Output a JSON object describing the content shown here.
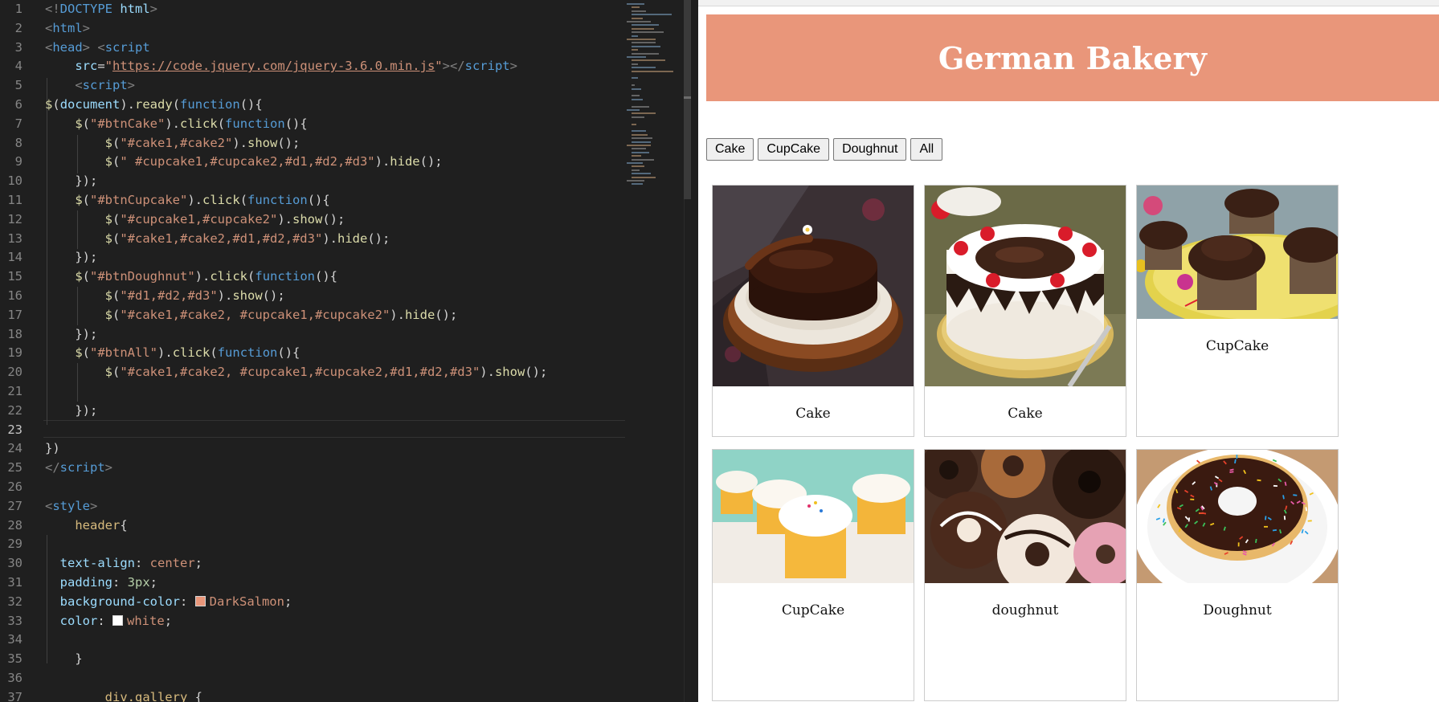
{
  "editor": {
    "lines": [
      {
        "n": "1"
      },
      {
        "n": "2"
      },
      {
        "n": "3"
      },
      {
        "n": "4"
      },
      {
        "n": "5"
      },
      {
        "n": "6"
      },
      {
        "n": "7"
      },
      {
        "n": "8"
      },
      {
        "n": "9"
      },
      {
        "n": "10"
      },
      {
        "n": "11"
      },
      {
        "n": "12"
      },
      {
        "n": "13"
      },
      {
        "n": "14"
      },
      {
        "n": "15"
      },
      {
        "n": "16"
      },
      {
        "n": "17"
      },
      {
        "n": "18"
      },
      {
        "n": "19"
      },
      {
        "n": "20"
      },
      {
        "n": "21"
      },
      {
        "n": "22"
      },
      {
        "n": "23"
      },
      {
        "n": "24"
      },
      {
        "n": "25"
      },
      {
        "n": "26"
      },
      {
        "n": "27"
      },
      {
        "n": "28"
      },
      {
        "n": "29"
      },
      {
        "n": "30"
      },
      {
        "n": "31"
      },
      {
        "n": "32"
      },
      {
        "n": "33"
      },
      {
        "n": "34"
      },
      {
        "n": "35"
      },
      {
        "n": "36"
      },
      {
        "n": "37"
      }
    ],
    "active_line": "23",
    "swatch_colors": {
      "darksalmon": "#e9967a",
      "white": "#ffffff"
    }
  },
  "preview": {
    "header_title": "German Bakery",
    "header_color": "#e9967a",
    "buttons": [
      {
        "label": "Cake"
      },
      {
        "label": "CupCake"
      },
      {
        "label": "Doughnut"
      },
      {
        "label": "All"
      }
    ],
    "cards": [
      {
        "caption": "Cake",
        "image": "chocolate-cake"
      },
      {
        "caption": "Cake",
        "image": "black-forest-cake"
      },
      {
        "caption": "CupCake",
        "image": "chocolate-cupcakes"
      },
      {
        "caption": "CupCake",
        "image": "vanilla-cupcakes"
      },
      {
        "caption": "doughnut",
        "image": "assorted-doughnuts"
      },
      {
        "caption": "Doughnut",
        "image": "sprinkle-doughnut"
      }
    ]
  }
}
